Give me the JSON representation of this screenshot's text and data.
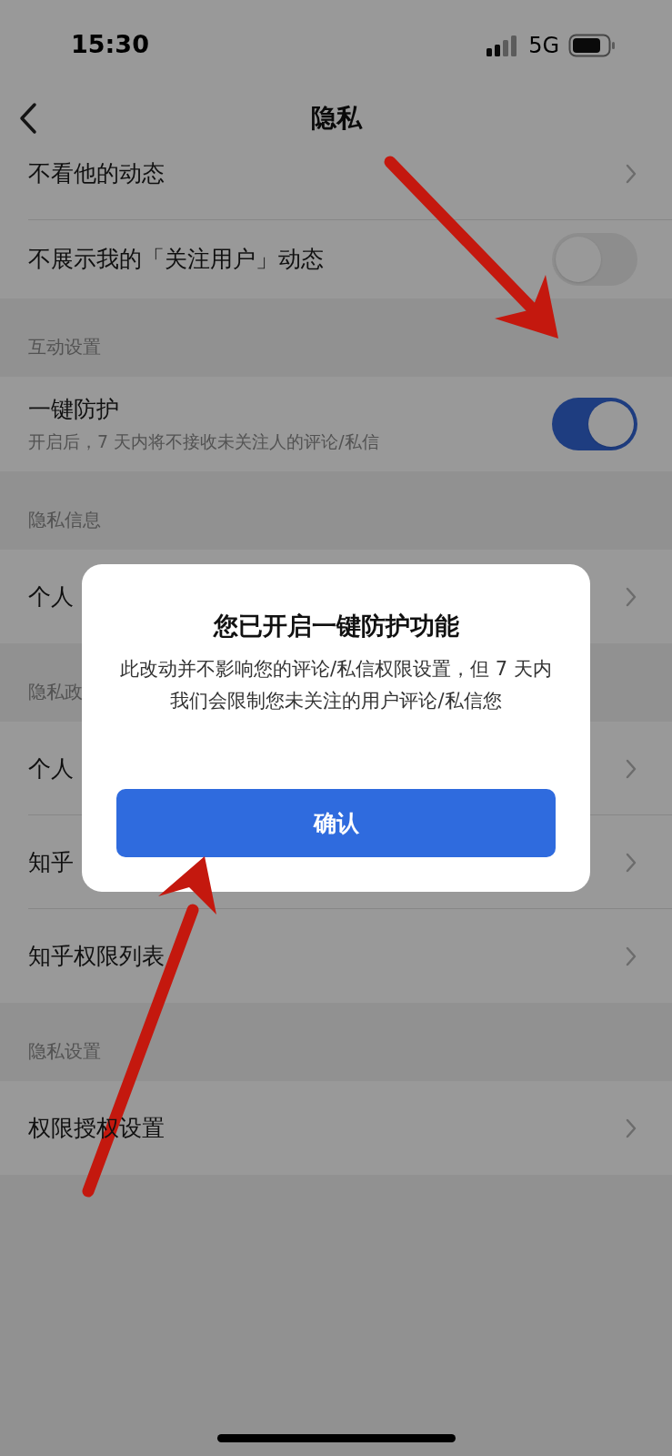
{
  "status_bar": {
    "time": "15:30",
    "network": "5G"
  },
  "nav": {
    "title": "隐私"
  },
  "list": [
    {
      "kind": "link",
      "title": "不看他的动态"
    },
    {
      "kind": "toggle",
      "title": "不展示我的「关注用户」动态",
      "on": false
    },
    {
      "kind": "header",
      "title": "互动设置"
    },
    {
      "kind": "toggle",
      "title": "一键防护",
      "subtitle": "开启后，7 天内将不接收未关注人的评论/私信",
      "on": true
    },
    {
      "kind": "header",
      "title": "隐私信息"
    },
    {
      "kind": "link",
      "title": "个人"
    },
    {
      "kind": "header",
      "title": "隐私政"
    },
    {
      "kind": "link",
      "title": "个人"
    },
    {
      "kind": "link",
      "title": "知乎"
    },
    {
      "kind": "link",
      "title": "知乎权限列表"
    },
    {
      "kind": "header",
      "title": "隐私设置"
    },
    {
      "kind": "link",
      "title": "权限授权设置"
    }
  ],
  "dialog": {
    "title": "您已开启一键防护功能",
    "message": "此改动并不影响您的评论/私信权限设置，但 7 天内我们会限制您未关注的用户评论/私信您",
    "button": "确认"
  }
}
